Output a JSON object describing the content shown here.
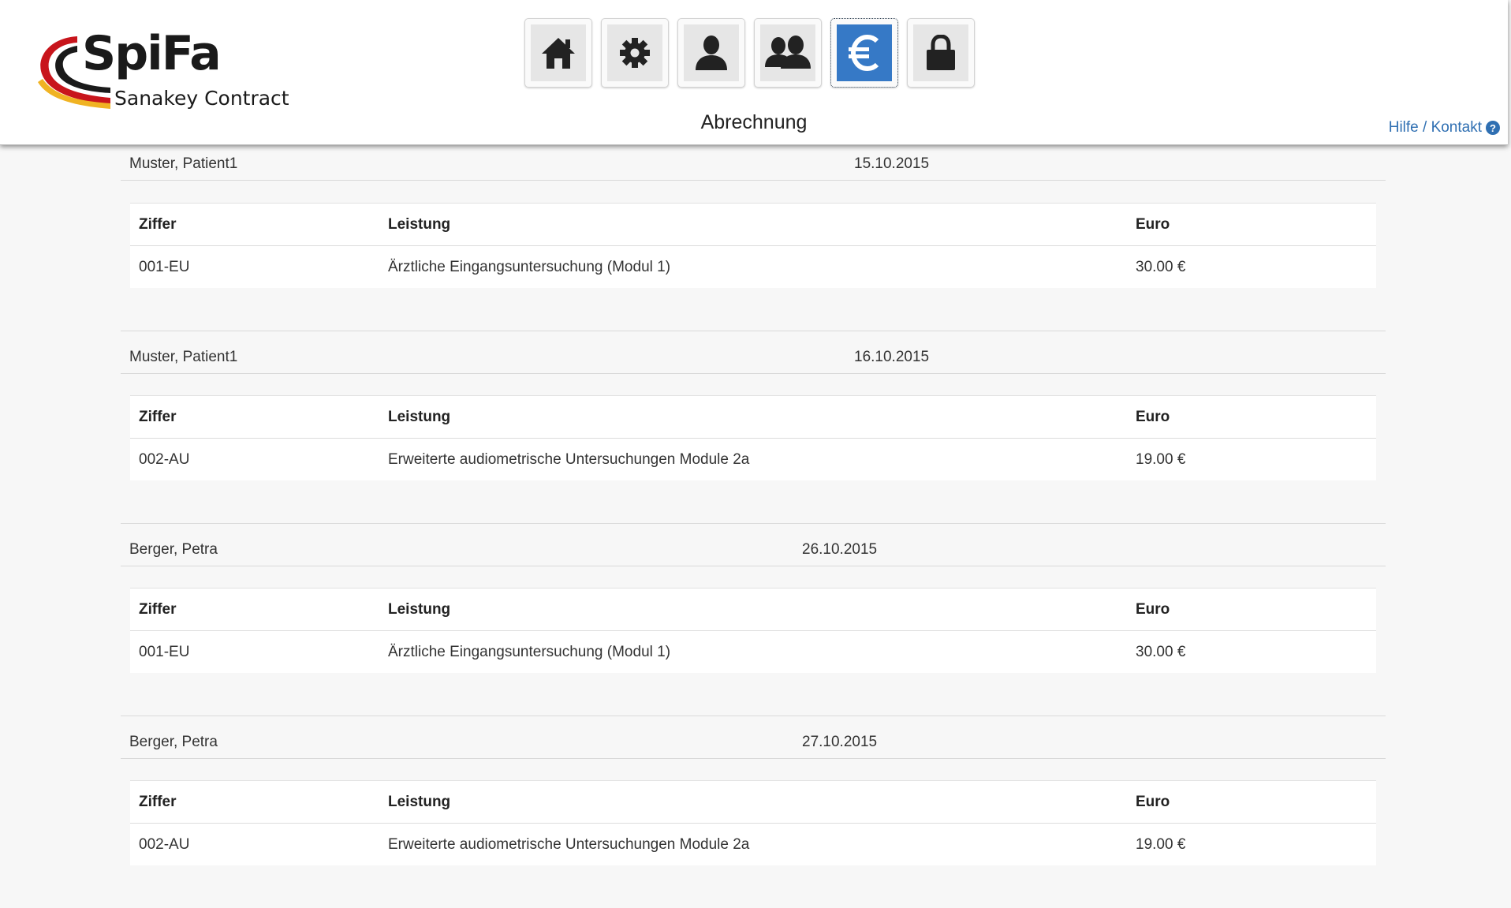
{
  "logo": {
    "name": "SpiFa",
    "subtitle": "Sanakey Contract"
  },
  "nav": {
    "items": [
      {
        "icon": "home-icon",
        "label": "Home"
      },
      {
        "icon": "gear-icon",
        "label": "Einstellungen"
      },
      {
        "icon": "user-icon",
        "label": "Patient"
      },
      {
        "icon": "users-icon",
        "label": "Patienten"
      },
      {
        "icon": "euro-icon",
        "label": "Abrechnung",
        "active": true
      },
      {
        "icon": "lock-icon",
        "label": "Abmelden"
      }
    ],
    "active_color": "#3679c6"
  },
  "page_title": "Abrechnung",
  "help": {
    "label": "Hilfe / Kontakt",
    "icon_glyph": "?"
  },
  "table_headers": {
    "ziffer": "Ziffer",
    "leistung": "Leistung",
    "euro": "Euro"
  },
  "entries": [
    {
      "patient": "Muster, Patient1",
      "date": "15.10.2015",
      "items": [
        {
          "ziffer": "001-EU",
          "leistung": "Ärztliche Eingangsuntersuchung (Modul 1)",
          "euro": "30.00 €"
        }
      ]
    },
    {
      "patient": "Muster, Patient1",
      "date": "16.10.2015",
      "items": [
        {
          "ziffer": "002-AU",
          "leistung": "Erweiterte audiometrische Untersuchungen Module 2a",
          "euro": "19.00 €"
        }
      ]
    },
    {
      "patient": "Berger, Petra",
      "date": "26.10.2015",
      "items": [
        {
          "ziffer": "001-EU",
          "leistung": "Ärztliche Eingangsuntersuchung (Modul 1)",
          "euro": "30.00 €"
        }
      ]
    },
    {
      "patient": "Berger, Petra",
      "date": "27.10.2015",
      "items": [
        {
          "ziffer": "002-AU",
          "leistung": "Erweiterte audiometrische Untersuchungen Module 2a",
          "euro": "19.00 €"
        }
      ]
    }
  ]
}
